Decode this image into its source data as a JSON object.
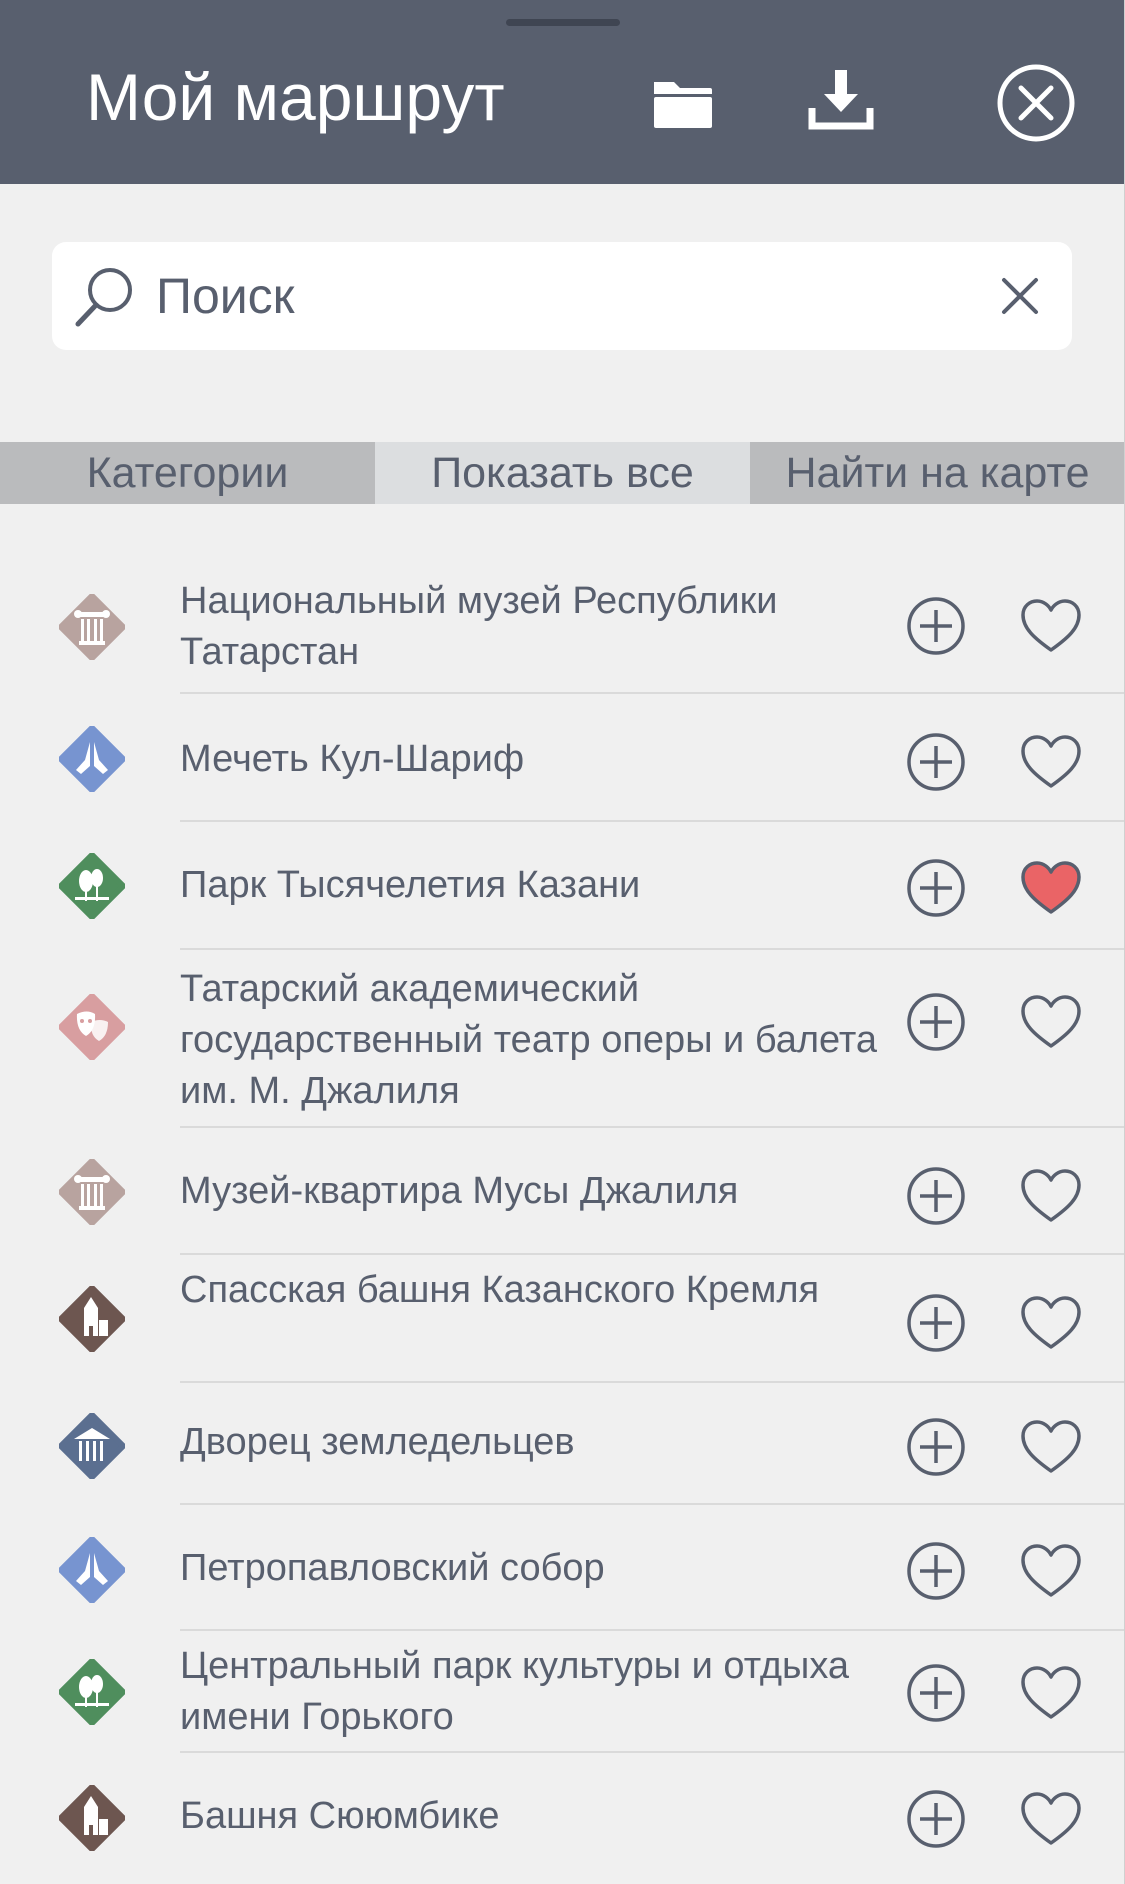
{
  "header": {
    "title": "Мой маршрут",
    "icons": [
      "folder-icon",
      "download-icon",
      "close-circle-icon"
    ],
    "background": "#585f6e"
  },
  "search": {
    "placeholder": "Поиск",
    "value": ""
  },
  "tabs": [
    {
      "label": "Категории",
      "active": false
    },
    {
      "label": "Показать все",
      "active": true
    },
    {
      "label": "Найти на карте",
      "active": false
    }
  ],
  "colors": {
    "text": "#585f6e",
    "favorite_active": "#ea6466",
    "museum": "#b8a39f",
    "religion": "#7794d0",
    "park": "#4f8e5d",
    "theatre": "#d89ea0",
    "architecture": "#6d5650",
    "government": "#5b6f90"
  },
  "places": [
    {
      "name": "Национальный музей Республики Татарстан",
      "category_icon": "museum-column-icon",
      "favorite": false
    },
    {
      "name": "Мечеть Кул-Шариф",
      "category_icon": "praying-hands-icon",
      "favorite": false
    },
    {
      "name": "Парк Тысячелетия Казани",
      "category_icon": "park-trees-icon",
      "favorite": true
    },
    {
      "name": "Татарский академический государственный театр оперы и балета им. М. Джалиля",
      "category_icon": "theatre-masks-icon",
      "favorite": false
    },
    {
      "name": "Музей-квартира Мусы Джалиля",
      "category_icon": "museum-column-icon",
      "favorite": false
    },
    {
      "name": "Спасская башня Казанского Кремля",
      "category_icon": "castle-tower-icon",
      "favorite": false
    },
    {
      "name": "Дворец земледельцев",
      "category_icon": "palace-columns-icon",
      "favorite": false
    },
    {
      "name": "Петропавловский собор",
      "category_icon": "praying-hands-icon",
      "favorite": false
    },
    {
      "name": "Центральный парк культуры и отдыха имени Горького",
      "category_icon": "park-trees-icon",
      "favorite": false
    },
    {
      "name": "Башня Сююмбике",
      "category_icon": "castle-tower-icon",
      "favorite": false
    }
  ]
}
